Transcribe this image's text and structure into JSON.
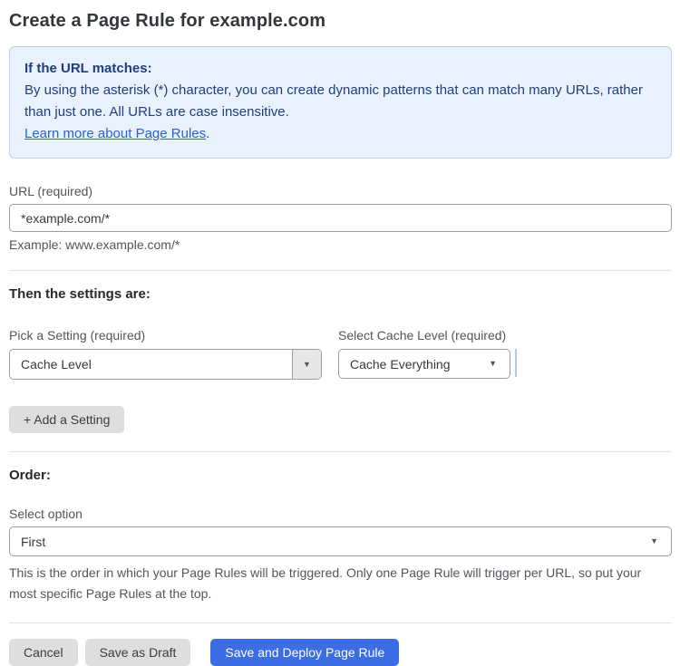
{
  "page": {
    "title": "Create a Page Rule for example.com"
  },
  "info_box": {
    "heading": "If the URL matches:",
    "body": "By using the asterisk (*) character, you can create dynamic patterns that can match many URLs, rather than just one. All URLs are case insensitive.",
    "link_label": "Learn more about Page Rules",
    "link_suffix": "."
  },
  "url_field": {
    "label": "URL (required)",
    "value": "*example.com/*",
    "help": "Example: www.example.com/*"
  },
  "settings_section": {
    "heading": "Then the settings are:",
    "setting_picker": {
      "label": "Pick a Setting (required)",
      "value": "Cache Level"
    },
    "cache_level_picker": {
      "label": "Select Cache Level (required)",
      "value": "Cache Everything"
    },
    "add_setting_label": "+ Add a Setting"
  },
  "order_section": {
    "heading": "Order:",
    "select_label": "Select option",
    "value": "First",
    "help": "This is the order in which your Page Rules will be triggered. Only one Page Rule will trigger per URL, so put your most specific Page Rules at the top."
  },
  "footer": {
    "cancel_label": "Cancel",
    "save_draft_label": "Save as Draft",
    "save_deploy_label": "Save and Deploy Page Rule"
  },
  "icons": {
    "dropdown_arrow": "▼"
  },
  "colors": {
    "accent_blue": "#3c6de5",
    "info_background": "#e9f1fc",
    "info_border": "#bcd2f2",
    "info_text": "#20407c",
    "link_blue": "#2c5fd3",
    "input_border": "#9a9da2",
    "button_gray": "#dededf",
    "separator_blue": "#aacdea"
  }
}
